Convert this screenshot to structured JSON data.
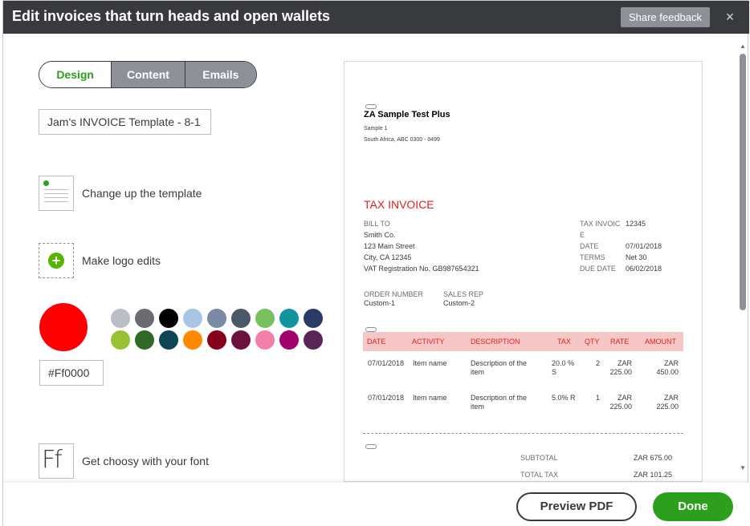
{
  "header": {
    "title": "Edit invoices that turn heads and open wallets",
    "feedback_label": "Share feedback",
    "close_glyph": "×"
  },
  "tabs": [
    {
      "label": "Design",
      "active": true
    },
    {
      "label": "Content",
      "active": false
    },
    {
      "label": "Emails",
      "active": false
    }
  ],
  "template_name": "Jam's INVOICE Template - 8-1",
  "options": {
    "change_template": "Change up the template",
    "logo_edits": "Make logo edits",
    "font": "Get choosy with your font",
    "font_glyph": "Ff"
  },
  "color": {
    "selected": "#ff0000",
    "hex_value": "#Ff0000",
    "palette": [
      "#babec5",
      "#6b6c72",
      "#000000",
      "#a9c4e4",
      "#7a8aa4",
      "#4a5965",
      "#78c05f",
      "#11949e",
      "#2b3a67",
      "#98c231",
      "#2f6b27",
      "#0e4654",
      "#ff8a00",
      "#86001c",
      "#6c1340",
      "#f47fa9",
      "#a2006b",
      "#5a2657"
    ]
  },
  "invoice": {
    "company": "ZA Sample Test Plus",
    "address1": "Sample 1",
    "address2": "South Africa, ABC 0300 - 0499",
    "title": "TAX INVOICE",
    "bill_to_label": "BILL TO",
    "bill_to": [
      "Smith Co.",
      "123 Main Street",
      "City, CA 12345",
      "VAT Registration No. GB987654321"
    ],
    "meta": [
      {
        "label": "TAX INVOIC",
        "value": "12345"
      },
      {
        "label": "E",
        "value": ""
      },
      {
        "label": "DATE",
        "value": "07/01/2018"
      },
      {
        "label": "TERMS",
        "value": "Net 30"
      },
      {
        "label": "DUE DATE",
        "value": "06/02/2018"
      }
    ],
    "order_number_label": "ORDER NUMBER",
    "order_number": "Custom-1",
    "sales_rep_label": "SALES REP",
    "sales_rep": "Custom-2",
    "columns": [
      "DATE",
      "ACTIVITY",
      "DESCRIPTION",
      "TAX",
      "QTY",
      "RATE",
      "AMOUNT"
    ],
    "rows": [
      {
        "date": "07/01/2018",
        "activity": "Item name",
        "description": "Description of the item",
        "tax": "20.0 % S",
        "qty": "2",
        "rate": "ZAR 225.00",
        "amount": "ZAR 450.00"
      },
      {
        "date": "07/01/2018",
        "activity": "Item name",
        "description": "Description of the item",
        "tax": "5.0% R",
        "qty": "1",
        "rate": "ZAR 225.00",
        "amount": "ZAR 225.00"
      }
    ],
    "subtotal_label": "SUBTOTAL",
    "subtotal": "ZAR 675.00",
    "total_tax_label": "TOTAL TAX",
    "total_tax": "ZAR 101.25",
    "accent": "#e21f1f"
  },
  "footer": {
    "preview_label": "Preview PDF",
    "done_label": "Done"
  }
}
